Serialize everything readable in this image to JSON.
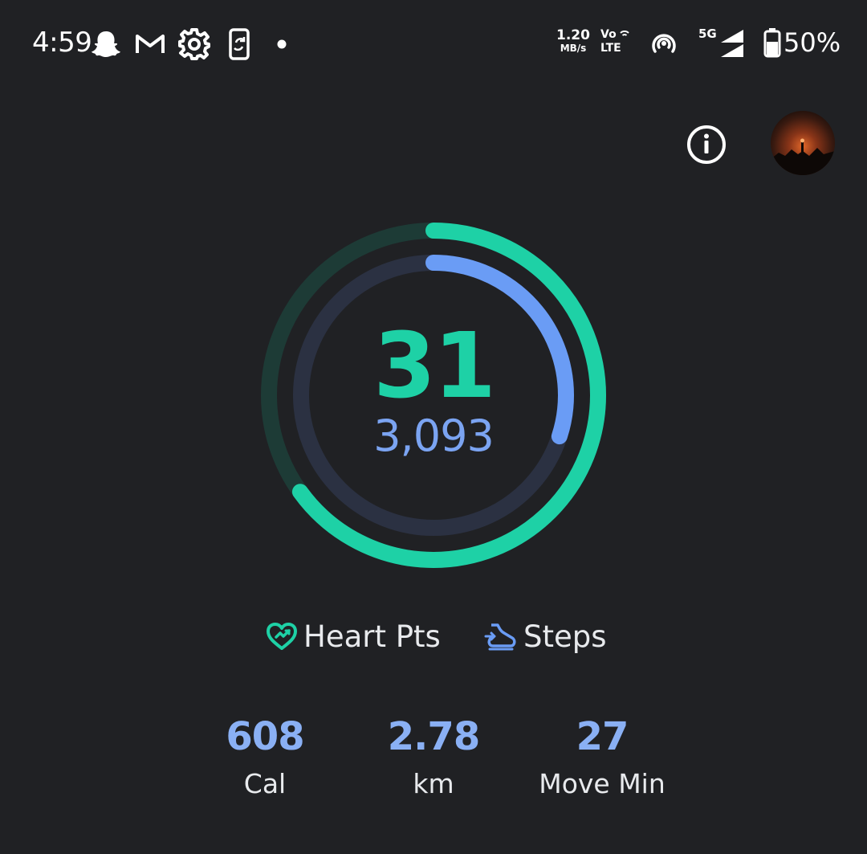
{
  "status_bar": {
    "time": "4:59",
    "net_speed_value": "1.20",
    "net_speed_unit": "MB/s",
    "volte_top": "Vo",
    "volte_bottom": "LTE",
    "network_type": "5G",
    "battery_percent": "50%",
    "icons": [
      "snapchat-icon",
      "gmail-icon",
      "settings-icon",
      "phone-sync-icon",
      "notification-dot-icon",
      "volte-icon",
      "hotspot-icon",
      "signal-icon",
      "battery-icon"
    ]
  },
  "actions": {
    "info_icon": "info-icon",
    "avatar": "avatar"
  },
  "rings": {
    "heart_pts_value": "31",
    "steps_value": "3,093",
    "heart_pts_progress": 0.65,
    "steps_progress": 0.3,
    "colors": {
      "heart": "#1ed1a6",
      "heart_track": "#1d3b36",
      "steps": "#6a9cf5",
      "steps_track": "#2b3142"
    }
  },
  "legend": {
    "heart_label": "Heart Pts",
    "steps_label": "Steps"
  },
  "stats": [
    {
      "value": "608",
      "label": "Cal"
    },
    {
      "value": "2.78",
      "label": "km"
    },
    {
      "value": "27",
      "label": "Move Min"
    }
  ]
}
